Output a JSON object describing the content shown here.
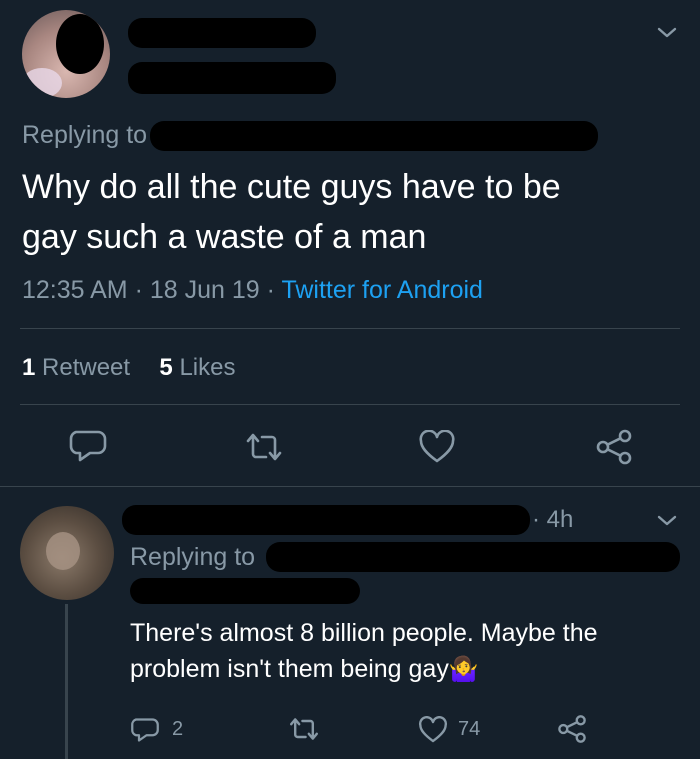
{
  "tweet": {
    "replying_to_label": "Replying to",
    "text_line1": "Why do all the cute guys have to be",
    "text_line2": "gay such a waste of a man",
    "time": "12:35 AM",
    "date": "18 Jun 19",
    "source": "Twitter for Android",
    "sep1": "·",
    "sep2": "·",
    "retweet_count": "1",
    "retweet_label": "Retweet",
    "likes_count": "5",
    "likes_label": "Likes"
  },
  "reply": {
    "time_ago": "· 4h",
    "replying_to_label": "Replying to",
    "text_line1": "There's almost 8 billion people. Maybe the",
    "text_line2": "problem isn't them being gay",
    "emoji": "🤷‍♀️",
    "reply_count": "2",
    "like_count": "74"
  },
  "colors": {
    "background": "#15202b",
    "text": "#ffffff",
    "muted": "#8899a6",
    "link": "#1da1f2",
    "divider": "#38444d"
  }
}
